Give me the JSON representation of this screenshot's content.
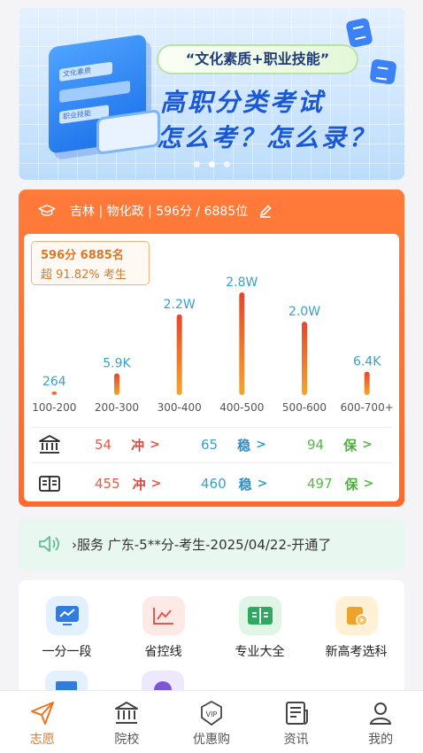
{
  "banner": {
    "pill": "“文化素质+职业技能”",
    "line1": "高职分类考试",
    "line2": "怎么考？怎么录？",
    "illus_line1": "文化素质",
    "illus_line2": "职业技能",
    "dots_count": 3,
    "active_dot": 1
  },
  "card": {
    "header": "吉林 | 物化政 | 596分 / 6885位",
    "rank_line1": "596分 6885名",
    "rank_line2": "超 91.82% 考生",
    "colors": {
      "accent": "#ff6a2c",
      "bar_top": "#e8452c",
      "bar_bottom": "#f4a62a",
      "value_label": "#3aa0c8"
    }
  },
  "chart_data": {
    "type": "bar",
    "categories": [
      "100-200",
      "200-300",
      "300-400",
      "400-500",
      "500-600",
      "600-700+"
    ],
    "values": [
      264,
      5900,
      22000,
      28000,
      20000,
      6400
    ],
    "labels": [
      "264",
      "5.9K",
      "2.2W",
      "2.8W",
      "2.0W",
      "6.4K"
    ],
    "ylim": [
      0,
      28000
    ],
    "grid": false,
    "title": "",
    "xlabel": "",
    "ylabel": ""
  },
  "rows": [
    {
      "icon": "school-icon",
      "chong": "54",
      "wen": "65",
      "bao": "94"
    },
    {
      "icon": "major-book-icon",
      "chong": "455",
      "wen": "460",
      "bao": "497"
    }
  ],
  "labels": {
    "chong": "冲",
    "wen": "稳",
    "bao": "保",
    "arrow": ">"
  },
  "notice": {
    "text": "›服务  广东-5**分-考生-2025/04/22-开通了"
  },
  "tools": [
    {
      "label": "一分一段",
      "icon": "score-chart-icon",
      "bg": "#e3f0ff",
      "fg": "#2f7de1"
    },
    {
      "label": "省控线",
      "icon": "line-chart-icon",
      "bg": "#ffe9e6",
      "fg": "#e25b4a"
    },
    {
      "label": "专业大全",
      "icon": "book-icon",
      "bg": "#dff5e6",
      "fg": "#2fa860"
    },
    {
      "label": "新高考选科",
      "icon": "select-subject-icon",
      "bg": "#fff0d6",
      "fg": "#f0a32a"
    }
  ],
  "tabs": [
    {
      "label": "志愿",
      "icon": "paper-plane-icon",
      "active": true
    },
    {
      "label": "院校",
      "icon": "school-icon",
      "active": false
    },
    {
      "label": "优惠购",
      "icon": "vip-icon",
      "active": false
    },
    {
      "label": "资讯",
      "icon": "news-icon",
      "active": false
    },
    {
      "label": "我的",
      "icon": "user-icon",
      "active": false
    }
  ]
}
